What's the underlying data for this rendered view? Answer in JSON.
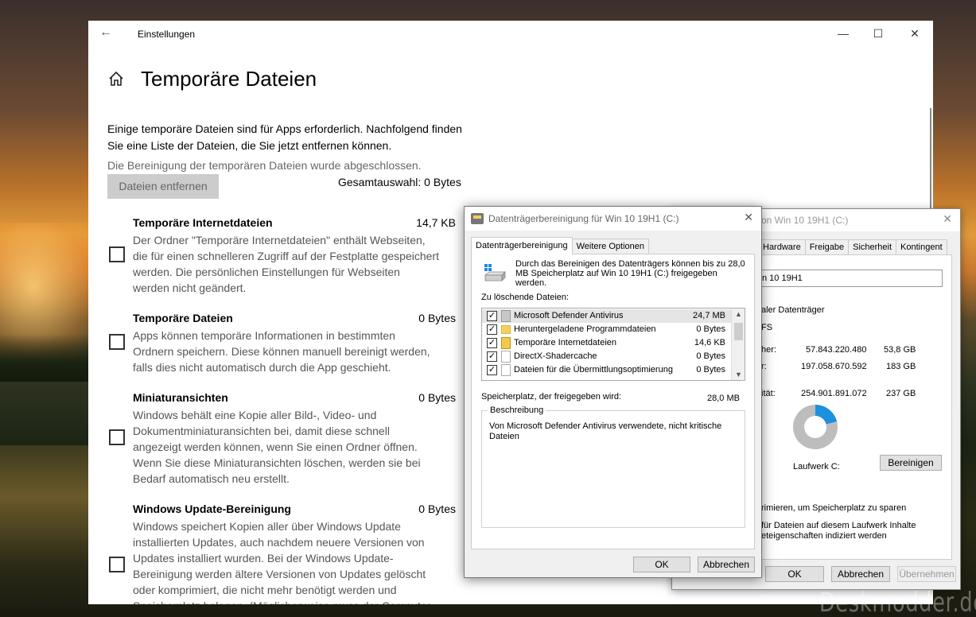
{
  "settings": {
    "title": "Einstellungen",
    "page_title": "Temporäre Dateien",
    "intro": "Einige temporäre Dateien sind für Apps erforderlich. Nachfolgend finden Sie eine Liste der Dateien, die Sie jetzt entfernen können.",
    "status": "Die Bereinigung der temporären Dateien wurde abgeschlossen.",
    "remove_label": "Dateien entfernen",
    "total_selection": "Gesamtauswahl: 0 Bytes",
    "items": [
      {
        "name": "Temporäre Internetdateien",
        "size": "14,7 KB",
        "checked": false,
        "desc": "Der Ordner \"Temporäre Internetdateien\" enthält Webseiten, die für einen schnelleren Zugriff auf der Festplatte gespeichert werden. Die persönlichen Einstellungen für Webseiten werden nicht geändert."
      },
      {
        "name": "Temporäre Dateien",
        "size": "0 Bytes",
        "checked": false,
        "desc": "Apps können temporäre Informationen in bestimmten Ordnern speichern. Diese können manuell bereinigt werden, falls dies nicht automatisch durch die App geschieht."
      },
      {
        "name": "Miniaturansichten",
        "size": "0 Bytes",
        "checked": false,
        "desc": "Windows behält eine Kopie aller Bild-, Video- und Dokumentminiaturansichten bei, damit diese schnell angezeigt werden können, wenn Sie einen Ordner öffnen. Wenn Sie diese Miniaturansichten löschen, werden sie bei Bedarf automatisch neu erstellt."
      },
      {
        "name": "Windows Update-Bereinigung",
        "size": "0 Bytes",
        "checked": false,
        "desc": "Windows speichert Kopien aller über Windows Update installierten Updates, auch nachdem neuere Versionen von Updates installiert wurden. Bei der Windows Update-Bereinigung werden ältere Versionen von Updates gelöscht oder komprimiert, die nicht mehr benötigt werden und Speicherplatz belegen. (Möglicherweise muss der Computer"
      }
    ]
  },
  "props": {
    "title": "on Win 10 19H1 (C:)",
    "tabs": [
      "Hardware",
      "Freigabe",
      "Sicherheit",
      "Kontingent"
    ],
    "name_value": "n 10 19H1",
    "type_text": "aler Datenträger",
    "fs_text": "FS",
    "used_label": "her:",
    "used_bytes": "57.843.220.480",
    "used_gb": "53,8 GB",
    "free_label": "r:",
    "free_bytes": "197.058.670.592",
    "free_gb": "183 GB",
    "cap_label": "ität:",
    "cap_bytes": "254.901.891.072",
    "cap_gb": "237 GB",
    "used_fraction": 0.21,
    "drive_label": "Laufwerk C:",
    "clean_button": "Bereinigen",
    "compress_text": "rimieren, um Speicherplatz zu sparen",
    "index_text_1": "für Dateien auf diesem Laufwerk Inhalte",
    "index_text_2": "eteigenschaften indiziert werden",
    "ok": "OK",
    "cancel": "Abbrechen",
    "apply": "Übernehmen"
  },
  "dialog": {
    "title": "Datenträgerbereinigung für Win 10 19H1 (C:)",
    "tabs": [
      "Datenträgerbereinigung",
      "Weitere Optionen"
    ],
    "intro": "Durch das Bereinigen des Datenträgers können bis zu 28,0 MB Speicherplatz auf Win 10 19H1 (C:) freigegeben werden.",
    "files_label": "Zu löschende Dateien:",
    "files": [
      {
        "name": "Microsoft Defender Antivirus",
        "size": "24,7 MB",
        "checked": true,
        "icon": "shield"
      },
      {
        "name": "Heruntergeladene Programmdateien",
        "size": "0 Bytes",
        "checked": true,
        "icon": "folder"
      },
      {
        "name": "Temporäre Internetdateien",
        "size": "14,6 KB",
        "checked": true,
        "icon": "lock"
      },
      {
        "name": "DirectX-Shadercache",
        "size": "0 Bytes",
        "checked": true,
        "icon": "file"
      },
      {
        "name": "Dateien für die Übermittlungsoptimierung",
        "size": "0 Bytes",
        "checked": true,
        "icon": "file"
      }
    ],
    "space_label": "Speicherplatz, der freigegeben wird:",
    "space_value": "28,0 MB",
    "desc_legend": "Beschreibung",
    "desc_text": "Von Microsoft Defender Antivirus verwendete, nicht kritische Dateien",
    "ok": "OK",
    "cancel": "Abbrechen"
  },
  "watermark": "Deskmodder.de"
}
